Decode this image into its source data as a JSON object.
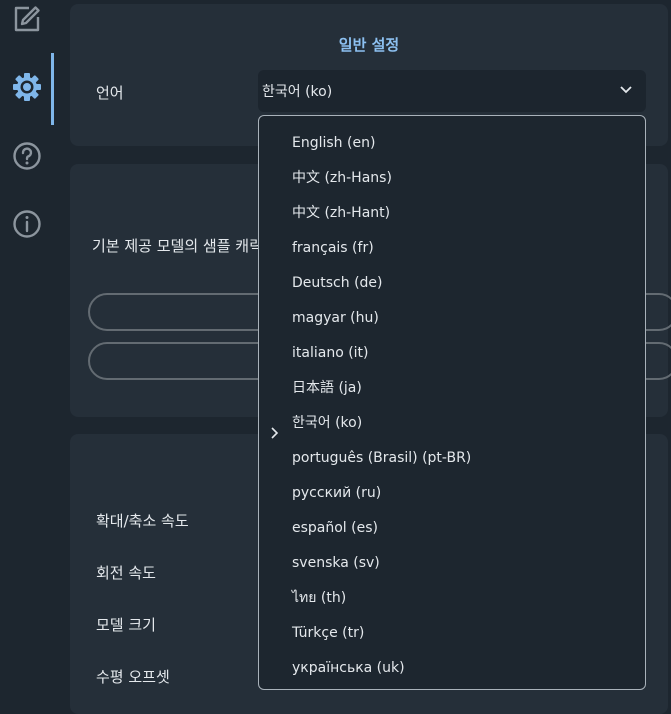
{
  "settings": {
    "title": "일반 설정",
    "language_label": "언어",
    "language_value": "한국어 (ko)",
    "language_options": [
      "English (en)",
      "中文 (zh-Hans)",
      "中文 (zh-Hant)",
      "français (fr)",
      "Deutsch (de)",
      "magyar (hu)",
      "italiano (it)",
      "日本語 (ja)",
      "한국어 (ko)",
      "português (Brasil) (pt-BR)",
      "русский (ru)",
      "español (es)",
      "svenska (sv)",
      "ไทย (th)",
      "Türkçe (tr)",
      "українська (uk)"
    ],
    "selected_index": 8
  },
  "samples": {
    "description": "기본 제공 모델의 샘플 캐릭"
  },
  "viewer": {
    "zoom_speed_label": "확대/축소 속도",
    "rotation_speed_label": "회전 속도",
    "model_size_label": "모델 크기",
    "horizontal_offset_label": "수평 오프셋"
  },
  "colors": {
    "accent": "#8cc0f0",
    "background": "#1d262f",
    "card": "#252f39"
  },
  "icons": [
    "edit-icon",
    "gear-icon",
    "help-icon",
    "info-icon",
    "chevron-down-icon",
    "chevron-right-icon"
  ]
}
